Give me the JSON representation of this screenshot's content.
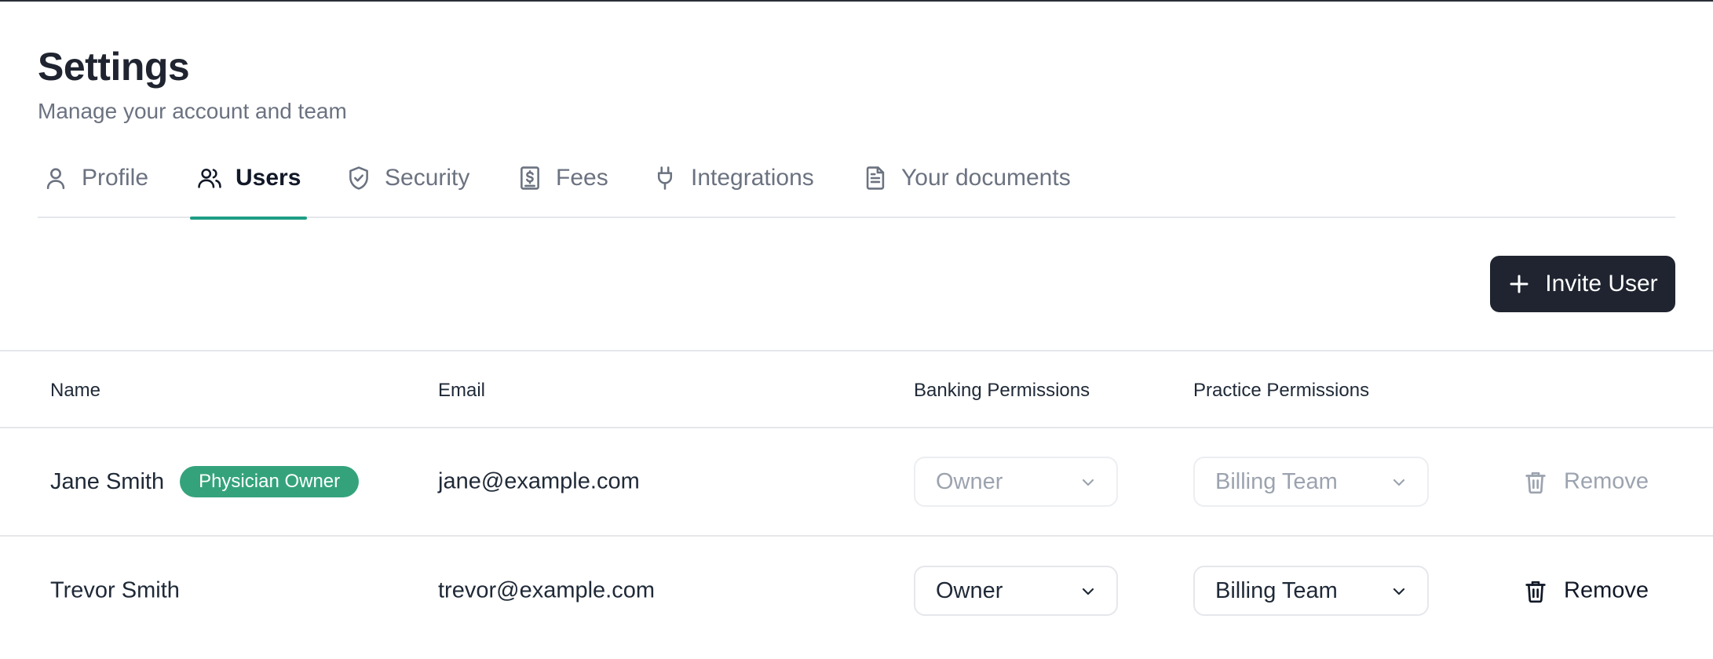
{
  "page": {
    "title": "Settings",
    "subtitle": "Manage your account and team"
  },
  "tabs": [
    {
      "label": "Profile",
      "icon": "user-icon",
      "active": false
    },
    {
      "label": "Users",
      "icon": "users-icon",
      "active": true
    },
    {
      "label": "Security",
      "icon": "shield-check-icon",
      "active": false
    },
    {
      "label": "Fees",
      "icon": "receipt-dollar-icon",
      "active": false
    },
    {
      "label": "Integrations",
      "icon": "plug-icon",
      "active": false
    },
    {
      "label": "Your documents",
      "icon": "document-icon",
      "active": false
    }
  ],
  "actions": {
    "invite_label": "Invite User",
    "invite_icon": "plus-icon"
  },
  "table": {
    "columns": [
      "Name",
      "Email",
      "Banking Permissions",
      "Practice Permissions"
    ],
    "rows": [
      {
        "name": "Jane Smith",
        "badge": "Physician Owner",
        "email": "jane@example.com",
        "banking": "Owner",
        "practice": "Billing Team",
        "remove_label": "Remove",
        "disabled": true
      },
      {
        "name": "Trevor Smith",
        "badge": "",
        "email": "trevor@example.com",
        "banking": "Owner",
        "practice": "Billing Team",
        "remove_label": "Remove",
        "disabled": false
      }
    ]
  },
  "colors": {
    "accent": "#1f9d86",
    "badge": "#34a37c",
    "primary_button": "#1f2430"
  }
}
